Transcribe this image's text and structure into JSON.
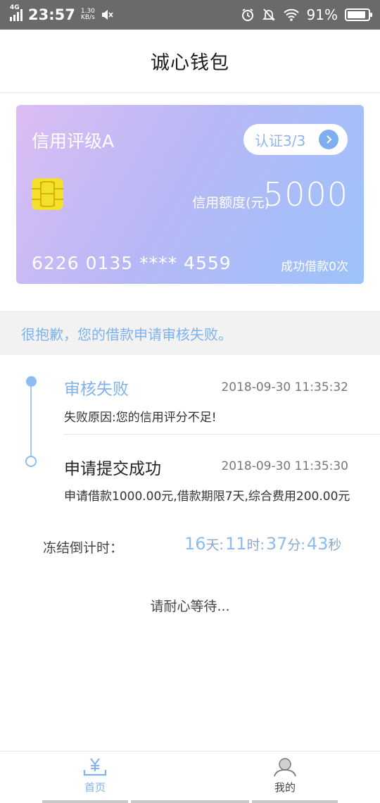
{
  "status_bar": {
    "network": "4G",
    "time": "23:57",
    "speed_value": "1.30",
    "speed_unit": "KB/s",
    "battery": "91%"
  },
  "header": {
    "title": "诚心钱包"
  },
  "card": {
    "rating": "信用评级A",
    "verify_label": "认证3/3",
    "limit_label": "信用额度(元)",
    "limit_value": "5000",
    "card_number": "6226 0135 **** 4559",
    "loans": "成功借款0次"
  },
  "notice": "很抱歉，您的借款申请审核失败。",
  "timeline": [
    {
      "title": "审核失败",
      "time": "2018-09-30 11:35:32",
      "desc": "失败原因:您的信用评分不足!"
    },
    {
      "title": "申请提交成功",
      "time": "2018-09-30 11:35:30",
      "desc": "申请借款1000.00元,借款期限7天,综合费用200.00元"
    }
  ],
  "countdown": {
    "label": "冻结倒计时：",
    "days": "16",
    "days_unit": "天:",
    "hours": "11",
    "hours_unit": "时:",
    "minutes": "37",
    "minutes_unit": "分:",
    "seconds": "43",
    "seconds_unit": "秒"
  },
  "wait_text": "请耐心等待...",
  "nav": [
    {
      "label": "首页",
      "icon": "home-yen-icon",
      "active": true
    },
    {
      "label": "我的",
      "icon": "user-icon",
      "active": false
    }
  ],
  "colors": {
    "accent": "#7fb2ec",
    "chip": "#f3e02b",
    "status_bar": "#6a6a6a"
  }
}
